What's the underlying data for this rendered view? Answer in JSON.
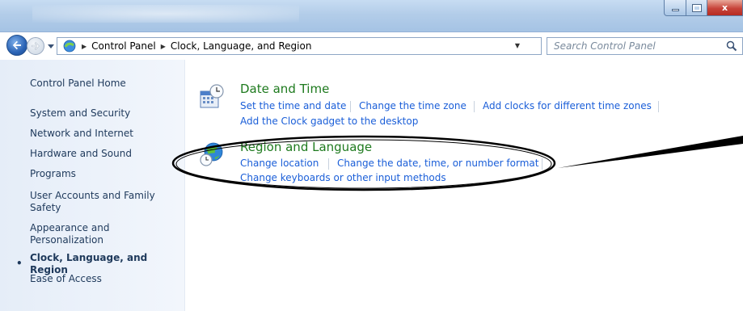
{
  "window": {
    "caption_buttons": {
      "minimize": "minimize",
      "maximize": "maximize",
      "close": "x"
    }
  },
  "address_bar": {
    "breadcrumbs": [
      "Control Panel",
      "Clock, Language, and Region"
    ],
    "search_placeholder": "Search Control Panel"
  },
  "sidebar": {
    "items": [
      {
        "label": "Control Panel Home"
      },
      {
        "label": "System and Security"
      },
      {
        "label": "Network and Internet"
      },
      {
        "label": "Hardware and Sound"
      },
      {
        "label": "Programs"
      },
      {
        "label": "User Accounts and Family Safety"
      },
      {
        "label": "Appearance and Personalization"
      },
      {
        "label": "Clock, Language, and Region",
        "current": true
      },
      {
        "label": "Ease of Access"
      }
    ]
  },
  "categories": [
    {
      "title": "Date and Time",
      "links": [
        "Set the time and date",
        "Change the time zone",
        "Add clocks for different time zones",
        "Add the Clock gadget to the desktop"
      ]
    },
    {
      "title": "Region and Language",
      "links": [
        "Change location",
        "Change the date, time, or number format",
        "Change keyboards or other input methods"
      ]
    }
  ],
  "colors": {
    "category_title": "#1e7a1e",
    "link": "#1a5ed8",
    "sidebar_text": "#1e395b",
    "annotation": "#000000"
  }
}
